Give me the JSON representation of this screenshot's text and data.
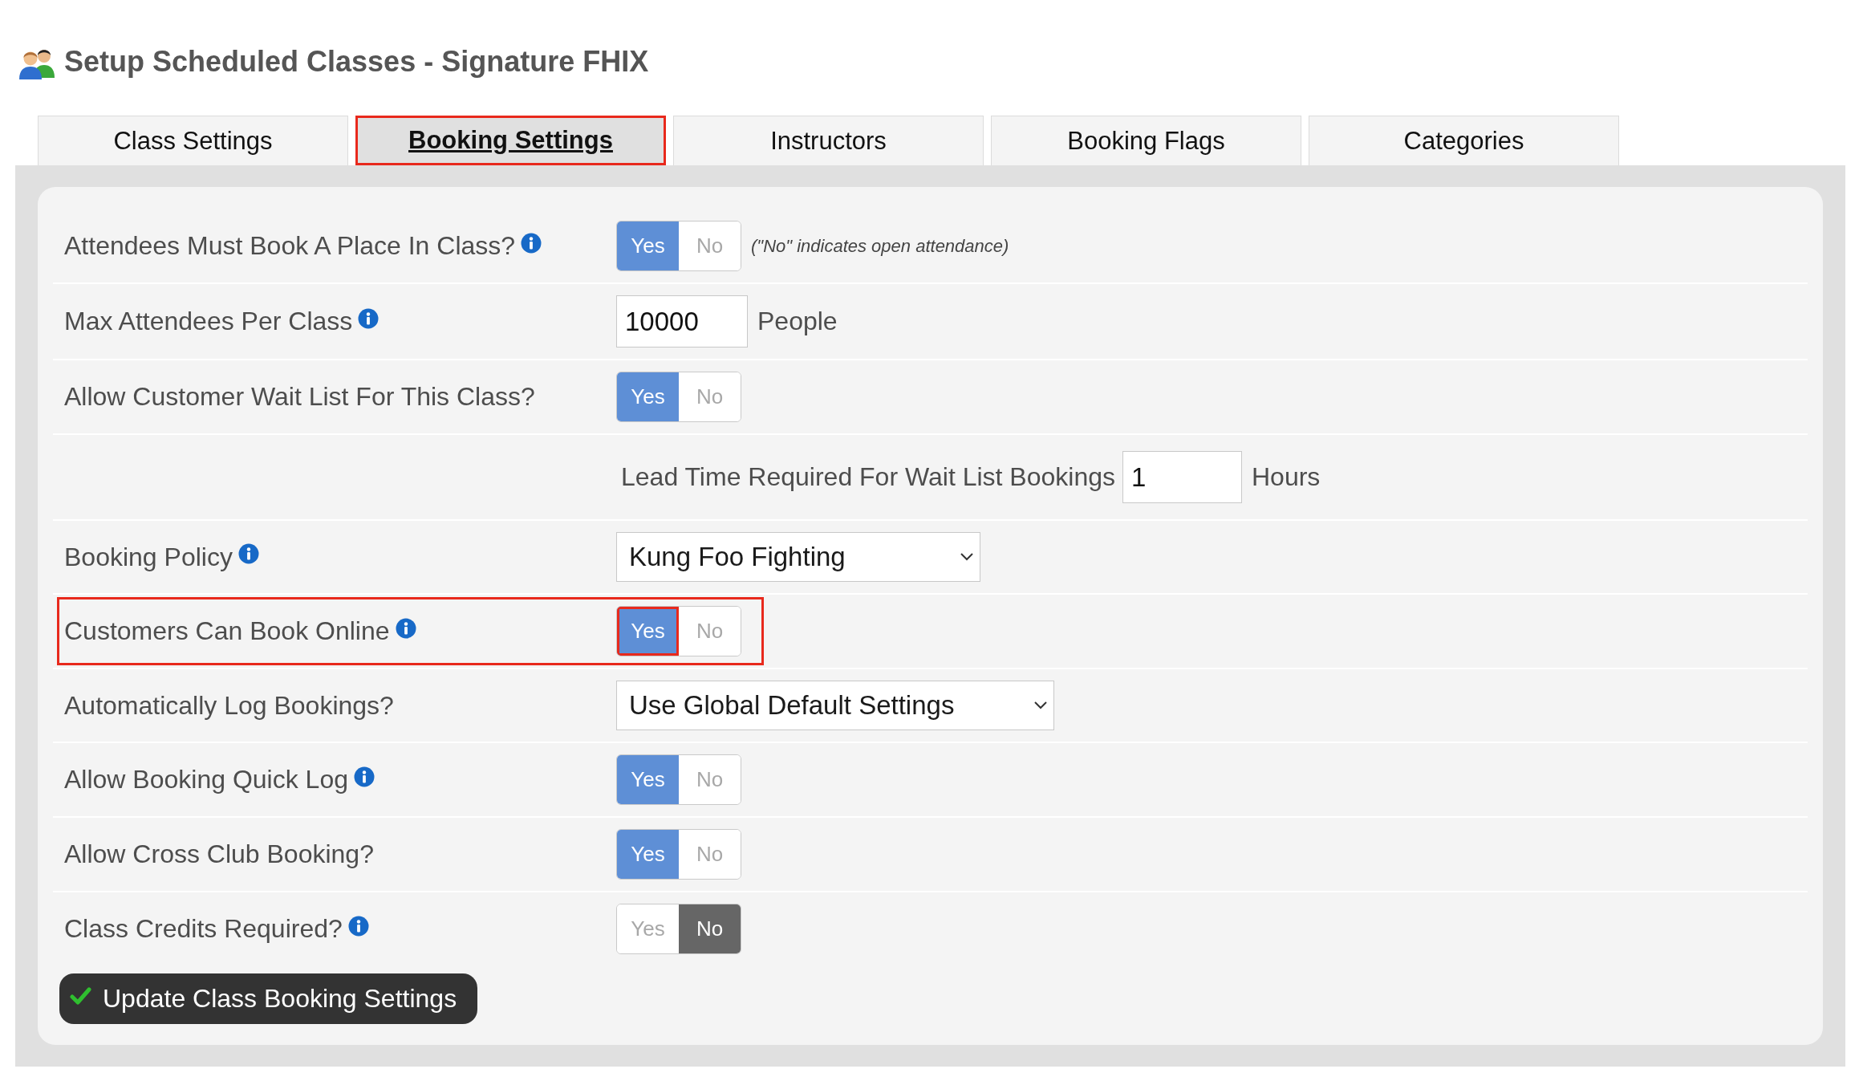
{
  "page": {
    "title": "Setup Scheduled Classes - Signature FHIX"
  },
  "tabs": [
    {
      "label": "Class Settings",
      "selected": false,
      "highlighted": false
    },
    {
      "label": "Booking Settings",
      "selected": true,
      "highlighted": true
    },
    {
      "label": "Instructors",
      "selected": false,
      "highlighted": false
    },
    {
      "label": "Booking Flags",
      "selected": false,
      "highlighted": false
    },
    {
      "label": "Categories",
      "selected": false,
      "highlighted": false
    }
  ],
  "settings": [
    {
      "kind": "toggle",
      "label": "Attendees Must Book A Place In Class?",
      "info": true,
      "highlighted": false,
      "options": [
        {
          "label": "Yes",
          "selected": true,
          "highlighted": false
        },
        {
          "label": "No",
          "selected": false,
          "highlighted": false
        }
      ],
      "note": "(\"No\" indicates open attendance)"
    },
    {
      "kind": "number",
      "label": "Max Attendees Per Class",
      "info": true,
      "highlighted": false,
      "value": "10000",
      "unit": "People"
    },
    {
      "kind": "toggle",
      "label": "Allow Customer Wait List For This Class?",
      "info": false,
      "highlighted": false,
      "options": [
        {
          "label": "Yes",
          "selected": true,
          "highlighted": false
        },
        {
          "label": "No",
          "selected": false,
          "highlighted": false
        }
      ]
    },
    {
      "kind": "sub_number",
      "label": "Lead Time Required For Wait List Bookings",
      "info": false,
      "highlighted": false,
      "value": "1",
      "unit": "Hours"
    },
    {
      "kind": "select",
      "label": "Booking Policy",
      "info": true,
      "highlighted": false,
      "value": "Kung Foo Fighting"
    },
    {
      "kind": "toggle",
      "label": "Customers Can Book Online",
      "info": true,
      "highlighted": true,
      "options": [
        {
          "label": "Yes",
          "selected": true,
          "highlighted": true
        },
        {
          "label": "No",
          "selected": false,
          "highlighted": false
        }
      ]
    },
    {
      "kind": "select",
      "label": "Automatically Log Bookings?",
      "info": false,
      "highlighted": false,
      "value": "Use Global Default Settings"
    },
    {
      "kind": "toggle",
      "label": "Allow Booking Quick Log",
      "info": true,
      "highlighted": false,
      "options": [
        {
          "label": "Yes",
          "selected": true,
          "highlighted": false
        },
        {
          "label": "No",
          "selected": false,
          "highlighted": false
        }
      ]
    },
    {
      "kind": "toggle",
      "label": "Allow Cross Club Booking?",
      "info": false,
      "highlighted": false,
      "options": [
        {
          "label": "Yes",
          "selected": true,
          "highlighted": false
        },
        {
          "label": "No",
          "selected": false,
          "highlighted": false
        }
      ]
    },
    {
      "kind": "toggle",
      "label": "Class Credits Required?",
      "info": true,
      "highlighted": false,
      "options": [
        {
          "label": "Yes",
          "selected": false,
          "highlighted": false
        },
        {
          "label": "No",
          "selected": true,
          "highlighted": false
        }
      ]
    }
  ],
  "submit_button": {
    "label": "Update Class Booking Settings"
  }
}
